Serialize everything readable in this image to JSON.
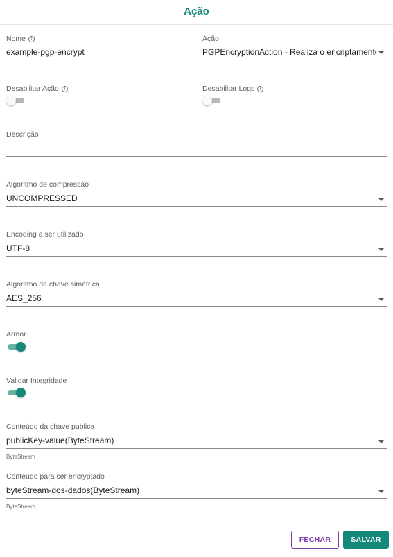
{
  "dialog": {
    "title": "Ação"
  },
  "fields": {
    "nome": {
      "label": "Nome",
      "value": "example-pgp-encrypt"
    },
    "acao": {
      "label": "Ação",
      "value": "PGPEncryptionAction - Realiza o encriptamento"
    },
    "desabilitar_acao": {
      "label": "Desabilitar Ação",
      "checked": false
    },
    "desabilitar_logs": {
      "label": "Desabilitar Logs",
      "checked": false
    },
    "descricao": {
      "label": "Descrição",
      "value": ""
    },
    "algoritmo_compressao": {
      "label": "Algoritmo de compressão",
      "value": "UNCOMPRESSED"
    },
    "encoding": {
      "label": "Encoding a ser utilizado",
      "value": "UTF-8"
    },
    "algoritmo_chave": {
      "label": "Algoritmo da chave simétrica",
      "value": "AES_256"
    },
    "armor": {
      "label": "Armor",
      "checked": true
    },
    "validar_integridade": {
      "label": "Validar Integridade",
      "checked": true
    },
    "chave_publica": {
      "label": "Conteúdo da chave publica",
      "value": "publicKey-value(ByteStream)",
      "hint": "ByteStream"
    },
    "conteudo_encryptado": {
      "label": "Conteúdo para ser encryptado",
      "value": "byteStream-dos-dados(ByteStream)",
      "hint": "ByteStream"
    }
  },
  "buttons": {
    "fechar": "FECHAR",
    "salvar": "SALVAR"
  },
  "colors": {
    "accent": "#14897a",
    "title": "#0f8a7a",
    "close": "#7a3aa8"
  },
  "icons": {
    "info": "info-icon",
    "dropdown": "chevron-down-icon"
  }
}
